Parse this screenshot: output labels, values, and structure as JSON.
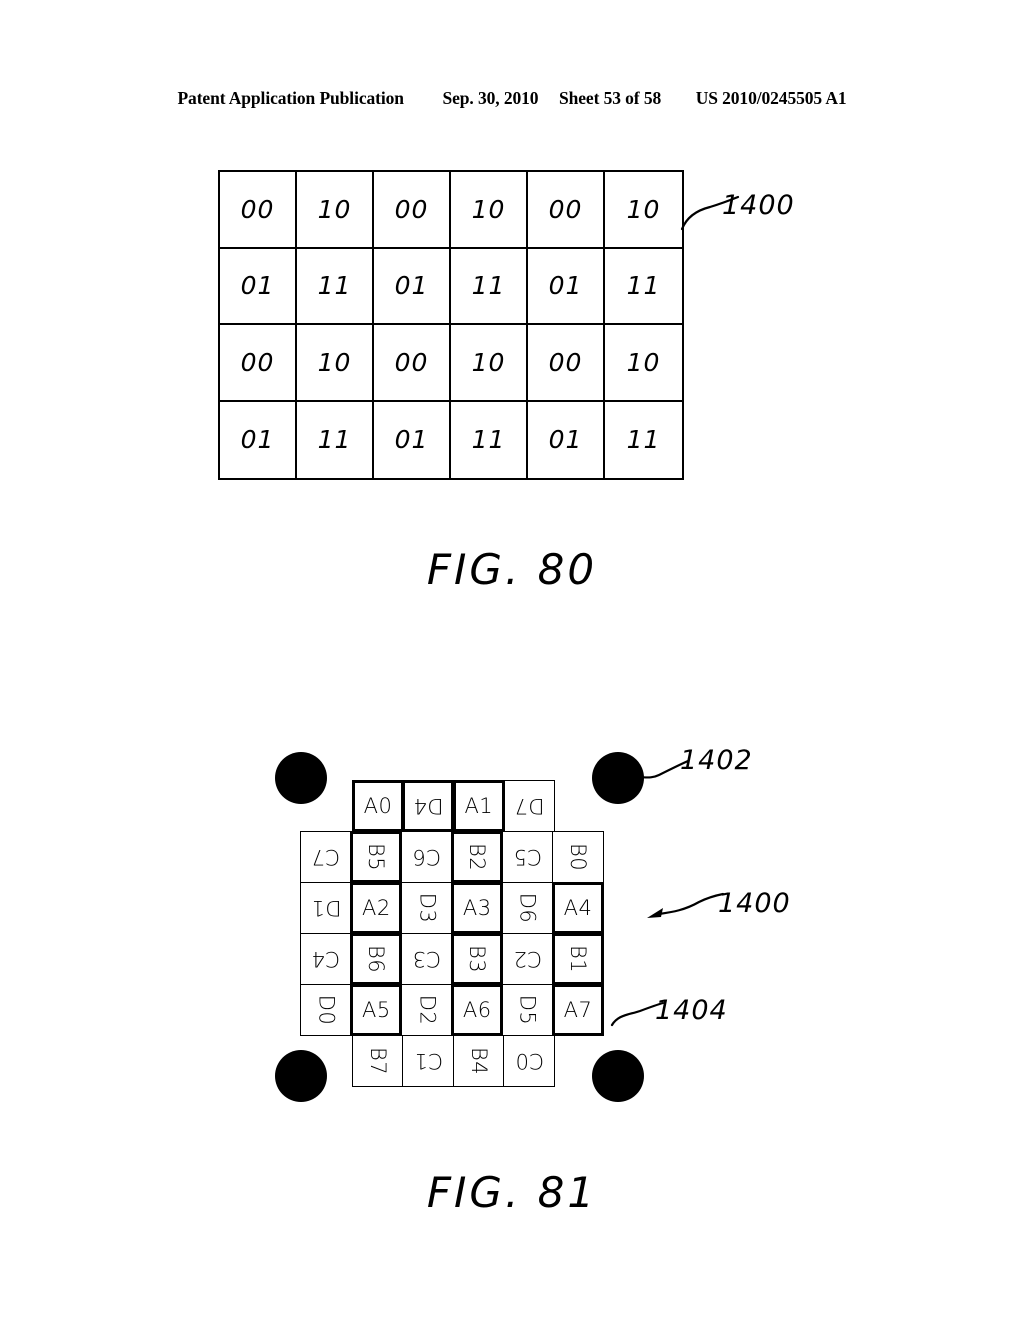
{
  "header": {
    "publication": "Patent Application Publication",
    "date": "Sep. 30, 2010",
    "sheet": "Sheet 53 of 58",
    "patent_number": "US 2010/0245505 A1"
  },
  "figures": [
    {
      "caption": "FIG. 80",
      "reference_label": "1400",
      "grid": {
        "columns": 6,
        "rows": 4,
        "values": [
          [
            "00",
            "10",
            "00",
            "10",
            "00",
            "10"
          ],
          [
            "01",
            "11",
            "01",
            "11",
            "01",
            "11"
          ],
          [
            "00",
            "10",
            "00",
            "10",
            "00",
            "10"
          ],
          [
            "01",
            "11",
            "01",
            "11",
            "01",
            "11"
          ]
        ]
      }
    },
    {
      "caption": "FIG. 81",
      "reference_labels": {
        "dot": "1402",
        "array": "1400",
        "cell": "1404"
      },
      "corner_dots": 4,
      "grid_rows": [
        {
          "offset_cells": 1,
          "cells": [
            {
              "label": "A0",
              "rotation": 0,
              "thick": true
            },
            {
              "label": "D4",
              "rotation": 180,
              "thick": true
            },
            {
              "label": "A1",
              "rotation": 0,
              "thick": true
            },
            {
              "label": "D7",
              "rotation": 180,
              "thick": false
            }
          ]
        },
        {
          "offset_cells": 0,
          "cells": [
            {
              "label": "C7",
              "rotation": 180,
              "thick": false
            },
            {
              "label": "B5",
              "rotation": 90,
              "thick": true
            },
            {
              "label": "C6",
              "rotation": 180,
              "thick": false
            },
            {
              "label": "B2",
              "rotation": 90,
              "thick": true
            },
            {
              "label": "C5",
              "rotation": 180,
              "thick": false
            },
            {
              "label": "B0",
              "rotation": 90,
              "thick": false
            }
          ]
        },
        {
          "offset_cells": 0,
          "cells": [
            {
              "label": "D1",
              "rotation": 180,
              "thick": false
            },
            {
              "label": "A2",
              "rotation": 0,
              "thick": true
            },
            {
              "label": "D3",
              "rotation": 90,
              "thick": false
            },
            {
              "label": "A3",
              "rotation": 0,
              "thick": true
            },
            {
              "label": "D6",
              "rotation": 90,
              "thick": false
            },
            {
              "label": "A4",
              "rotation": 0,
              "thick": true
            }
          ]
        },
        {
          "offset_cells": 0,
          "cells": [
            {
              "label": "C4",
              "rotation": 180,
              "thick": false
            },
            {
              "label": "B6",
              "rotation": 90,
              "thick": true
            },
            {
              "label": "C3",
              "rotation": 180,
              "thick": false
            },
            {
              "label": "B3",
              "rotation": 90,
              "thick": true
            },
            {
              "label": "C2",
              "rotation": 180,
              "thick": false
            },
            {
              "label": "B1",
              "rotation": 90,
              "thick": true
            }
          ]
        },
        {
          "offset_cells": 0,
          "cells": [
            {
              "label": "D0",
              "rotation": 90,
              "thick": false
            },
            {
              "label": "A5",
              "rotation": 0,
              "thick": true
            },
            {
              "label": "D2",
              "rotation": 90,
              "thick": false
            },
            {
              "label": "A6",
              "rotation": 0,
              "thick": true
            },
            {
              "label": "D5",
              "rotation": 90,
              "thick": false
            },
            {
              "label": "A7",
              "rotation": 0,
              "thick": true
            }
          ]
        },
        {
          "offset_cells": 1,
          "cells": [
            {
              "label": "B7",
              "rotation": 90,
              "thick": false
            },
            {
              "label": "C1",
              "rotation": 180,
              "thick": false
            },
            {
              "label": "B4",
              "rotation": 90,
              "thick": false
            },
            {
              "label": "C0",
              "rotation": 180,
              "thick": false
            }
          ]
        }
      ]
    }
  ],
  "colors": {
    "ink": "#000000",
    "page": "#ffffff"
  }
}
